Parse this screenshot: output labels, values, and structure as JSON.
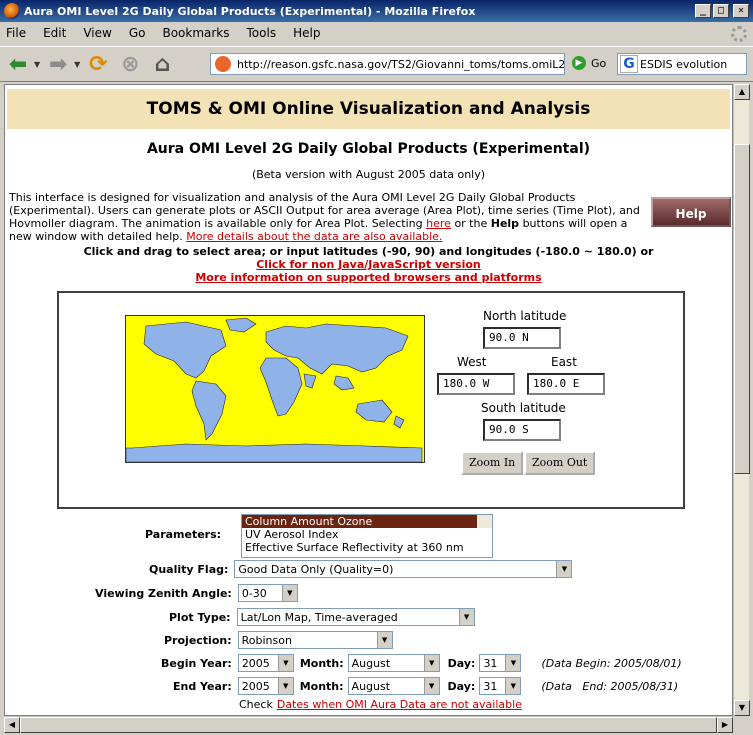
{
  "window": {
    "title": "Aura OMI Level 2G Daily Global Products (Experimental) - Mozilla Firefox"
  },
  "menu": [
    "File",
    "Edit",
    "View",
    "Go",
    "Bookmarks",
    "Tools",
    "Help"
  ],
  "toolbar": {
    "url": "http://reason.gsfc.nasa.gov/TS2/Giovanni_toms/toms.omiL2G.s",
    "go_label": "Go",
    "search_value": "ESDIS evolution"
  },
  "page": {
    "banner": "TOMS & OMI Online Visualization and Analysis",
    "subtitle": "Aura OMI Level 2G Daily Global Products (Experimental)",
    "beta": "(Beta version with August 2005 data only)",
    "intro_text": "This interface is designed for visualization and analysis of the Aura OMI Level 2G Daily Global Products (Experimental). Users can generate plots or ASCII Output for area average (Area Plot), time series (Time Plot), and Hovmoller diagram. The animation is available only for Area Plot. Selecting",
    "intro_here": "here",
    "intro_mid": "or the",
    "intro_help_bold": "Help",
    "intro_tail": "buttons will open a new window with detailed help.",
    "intro_more_link": "More details about the data are also available.",
    "help_button": "Help",
    "click_drag": "Click and drag to select area; or input latitudes (-90, 90) and longitudes (-180.0 ~ 180.0) or",
    "non_java_link": "Click for non Java/JavaScript version",
    "browsers_link": "More information on supported browsers and platforms"
  },
  "map": {
    "north_label": "North latitude",
    "north_value": "90.0 N",
    "west_label": "West",
    "west_value": "180.0 W",
    "east_label": "East",
    "east_value": "180.0 E",
    "south_label": "South latitude",
    "south_value": "90.0 S",
    "zoom_in": "Zoom In",
    "zoom_out": "Zoom Out"
  },
  "form": {
    "parameters_label": "Parameters:",
    "parameters_options": [
      "Column Amount Ozone",
      "UV Aerosol Index",
      "Effective Surface Reflectivity at 360 nm"
    ],
    "quality_label": "Quality Flag:",
    "quality_value": "Good Data Only (Quality=0)",
    "vza_label": "Viewing Zenith Angle:",
    "vza_value": "0-30",
    "plot_type_label": "Plot Type:",
    "plot_type_value": "Lat/Lon Map, Time-averaged",
    "projection_label": "Projection:",
    "projection_value": "Robinson",
    "begin_year_label": "Begin Year:",
    "begin_year": "2005",
    "end_year_label": "End Year:",
    "end_year": "2005",
    "month_label": "Month:",
    "begin_month": "August",
    "end_month": "August",
    "day_label": "Day:",
    "begin_day": "31",
    "end_day": "31",
    "data_begin": "(Data Begin: 2005/08/01)",
    "data_end": "(Data   End: 2005/08/31)",
    "check_text": "Check",
    "check_link": "Dates when OMI Aura Data are not available"
  }
}
